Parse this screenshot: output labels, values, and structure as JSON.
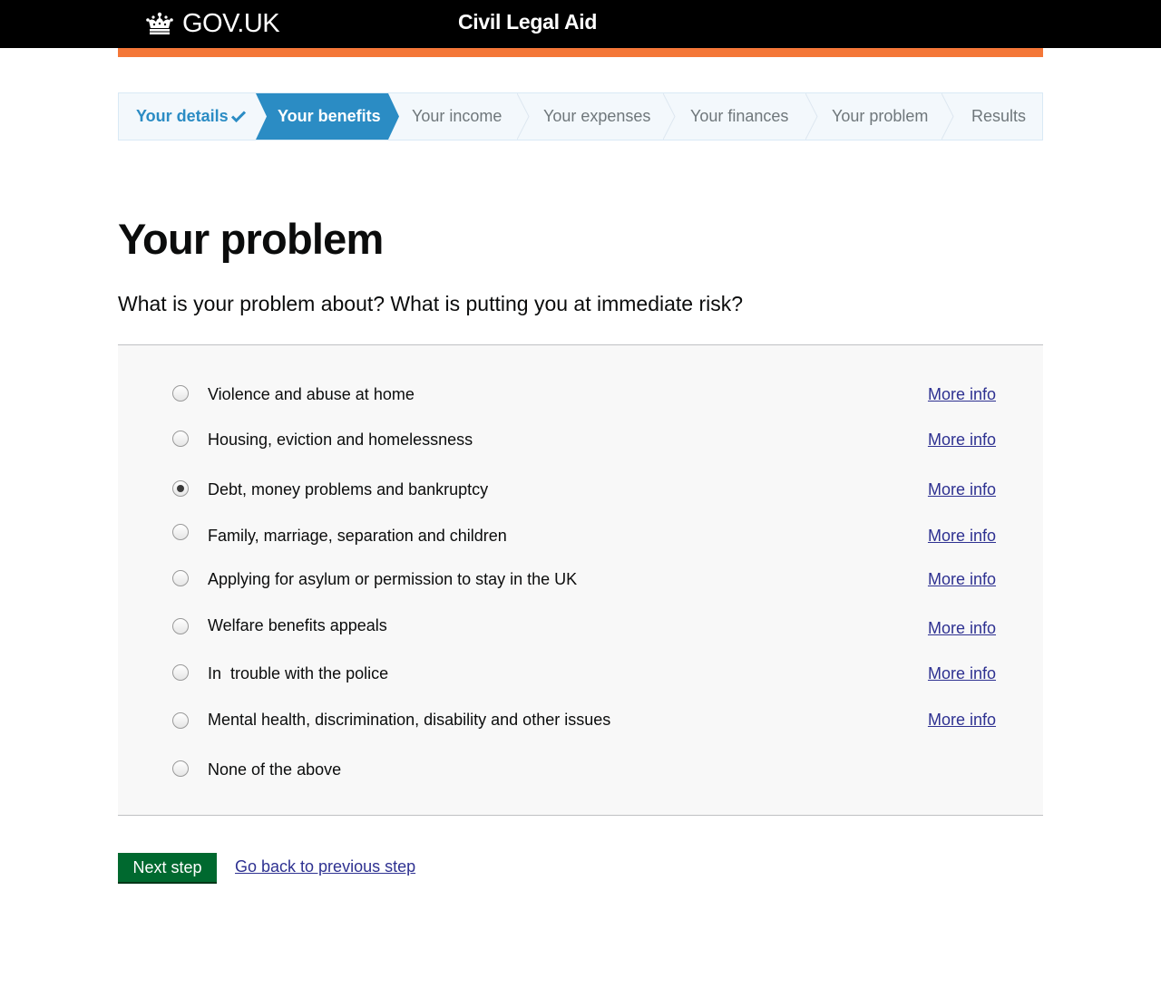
{
  "header": {
    "logo_text": "GOV.UK",
    "logo_icon": "crown-icon",
    "service_name": "Civil Legal Aid"
  },
  "colors": {
    "header_bg": "#000000",
    "accent_bar": "#f47738",
    "progress_active": "#2b8cc4",
    "button_green": "#00692f",
    "link": "#2e3191"
  },
  "progress": {
    "steps": [
      {
        "label": "Your details",
        "state": "done",
        "icon": "check-icon"
      },
      {
        "label": "Your benefits",
        "state": "active"
      },
      {
        "label": "Your income",
        "state": "upcoming"
      },
      {
        "label": "Your expenses",
        "state": "upcoming"
      },
      {
        "label": "Your finances",
        "state": "upcoming"
      },
      {
        "label": "Your problem",
        "state": "upcoming"
      },
      {
        "label": "Results",
        "state": "upcoming"
      }
    ]
  },
  "page": {
    "title": "Your problem",
    "question": "What is your problem about? What is putting you at immediate risk?"
  },
  "options": [
    {
      "label": "Violence and abuse at home",
      "more_info": "More info",
      "checked": false
    },
    {
      "label": "Housing, eviction and homelessness",
      "more_info": "More info",
      "checked": false
    },
    {
      "label": "Debt, money problems and bankruptcy",
      "more_info": "More info",
      "checked": true
    },
    {
      "label": "Family, marriage, separation and children",
      "more_info": "More info",
      "checked": false
    },
    {
      "label": "Applying for asylum or permission to stay in the UK",
      "more_info": "More info",
      "checked": false
    },
    {
      "label": "Welfare benefits appeals",
      "more_info": "More info",
      "checked": false
    },
    {
      "label": "In  trouble with the police",
      "more_info": "More info",
      "checked": false
    },
    {
      "label": "Mental health, discrimination, disability and other issues",
      "more_info": "More info",
      "checked": false
    },
    {
      "label": "None of the above",
      "more_info": "",
      "checked": false
    }
  ],
  "actions": {
    "next_label": "Next step",
    "back_label": "Go back to previous step"
  }
}
